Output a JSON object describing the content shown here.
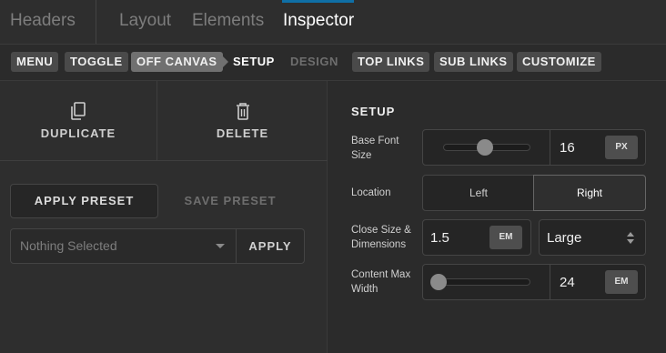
{
  "top_tabs": {
    "headers": "Headers",
    "layout": "Layout",
    "elements": "Elements",
    "inspector": "Inspector",
    "active": "Inspector"
  },
  "subnav": {
    "menu": "MENU",
    "toggle": "TOGGLE",
    "off_canvas": "OFF CANVAS",
    "setup": "SETUP",
    "design": "DESIGN",
    "top_links": "TOP LINKS",
    "sub_links": "SUB LINKS",
    "customize": "CUSTOMIZE"
  },
  "left_panel": {
    "duplicate_label": "DUPLICATE",
    "delete_label": "DELETE",
    "apply_preset_label": "APPLY PRESET",
    "save_preset_label": "SAVE PRESET",
    "preset_select_value": "Nothing Selected",
    "apply_label": "APPLY"
  },
  "setup": {
    "title": "SETUP",
    "base_font_size": {
      "label": "Base Font Size",
      "value": "16",
      "unit": "PX",
      "slider_fraction": 0.48
    },
    "location": {
      "label": "Location",
      "options": [
        "Left",
        "Right"
      ],
      "selected": "Right"
    },
    "close_size": {
      "label": "Close Size & Dimensions",
      "value": "1.5",
      "unit": "EM",
      "dimension_value": "Large"
    },
    "content_max_width": {
      "label": "Content Max Width",
      "value": "24",
      "unit": "EM",
      "slider_fraction": 0.0
    }
  },
  "colors": {
    "accent": "#0f6fa6",
    "background": "#2b2b2b",
    "chip": "#4a4a4a",
    "chip_highlight": "#707070"
  }
}
